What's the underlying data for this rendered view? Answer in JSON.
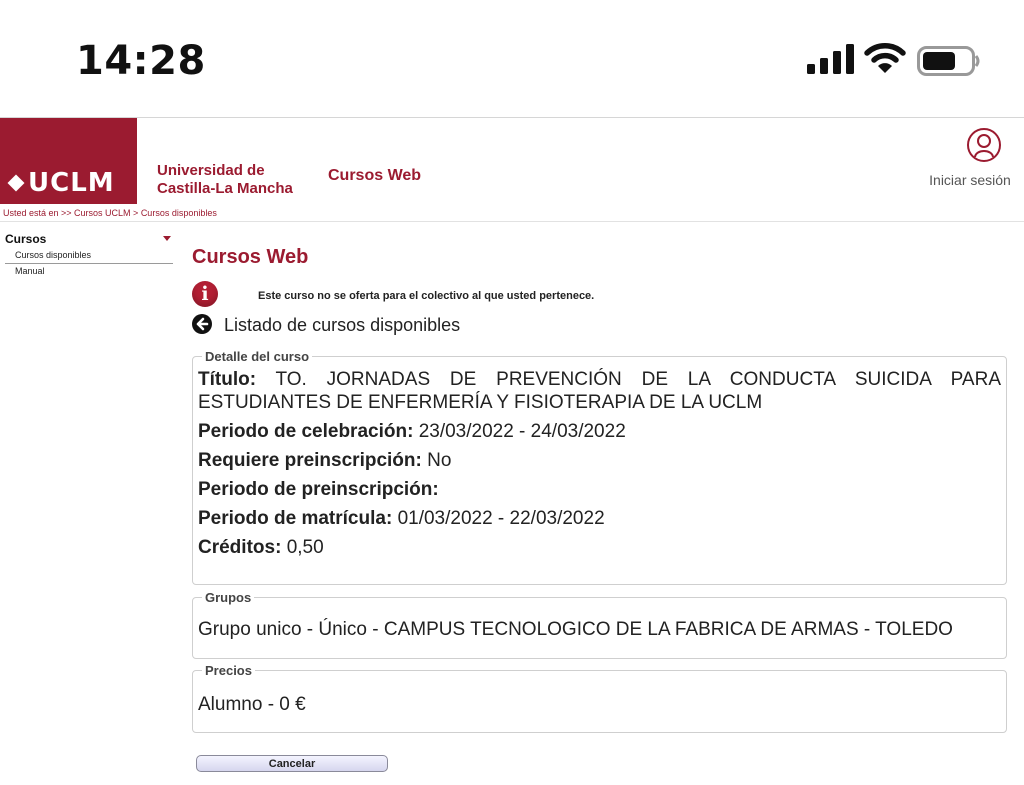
{
  "status_bar": {
    "time": "14:28"
  },
  "header": {
    "logo_text": "UCLM",
    "university_line1": "Universidad de",
    "university_line2": "Castilla-La Mancha",
    "site_title": "Cursos Web",
    "login_label": "Iniciar sesión"
  },
  "breadcrumb": "Usted está en >> Cursos UCLM  > Cursos disponibles",
  "sidebar": {
    "heading": "Cursos",
    "items": [
      {
        "label": "Cursos disponibles"
      },
      {
        "label": "Manual"
      }
    ]
  },
  "main": {
    "title": "Cursos Web",
    "notice": "Este curso no se oferta para el colectivo al que usted pertenece.",
    "back_link": "Listado de cursos disponibles",
    "detail": {
      "legend": "Detalle del curso",
      "titulo_label": "Título:",
      "titulo_value": "TO. JORNADAS DE PREVENCIÓN DE LA CONDUCTA SUICIDA PARA ESTUDIANTES DE ENFERMERÍA Y FISIOTERAPIA DE LA UCLM",
      "celebracion_label": "Periodo de celebración:",
      "celebracion_value": "23/03/2022 - 24/03/2022",
      "preinscripcion_req_label": "Requiere preinscripción:",
      "preinscripcion_req_value": "No",
      "preinscripcion_periodo_label": "Periodo de preinscripción:",
      "matricula_label": "Periodo de matrícula:",
      "matricula_value": "01/03/2022 - 22/03/2022",
      "creditos_label": "Créditos:",
      "creditos_value": "0,50"
    },
    "grupos": {
      "legend": "Grupos",
      "text": "Grupo unico - Único - CAMPUS TECNOLOGICO DE LA FABRICA DE ARMAS - TOLEDO"
    },
    "precios": {
      "legend": "Precios",
      "text": "Alumno - 0 €"
    },
    "cancel_label": "Cancelar"
  }
}
